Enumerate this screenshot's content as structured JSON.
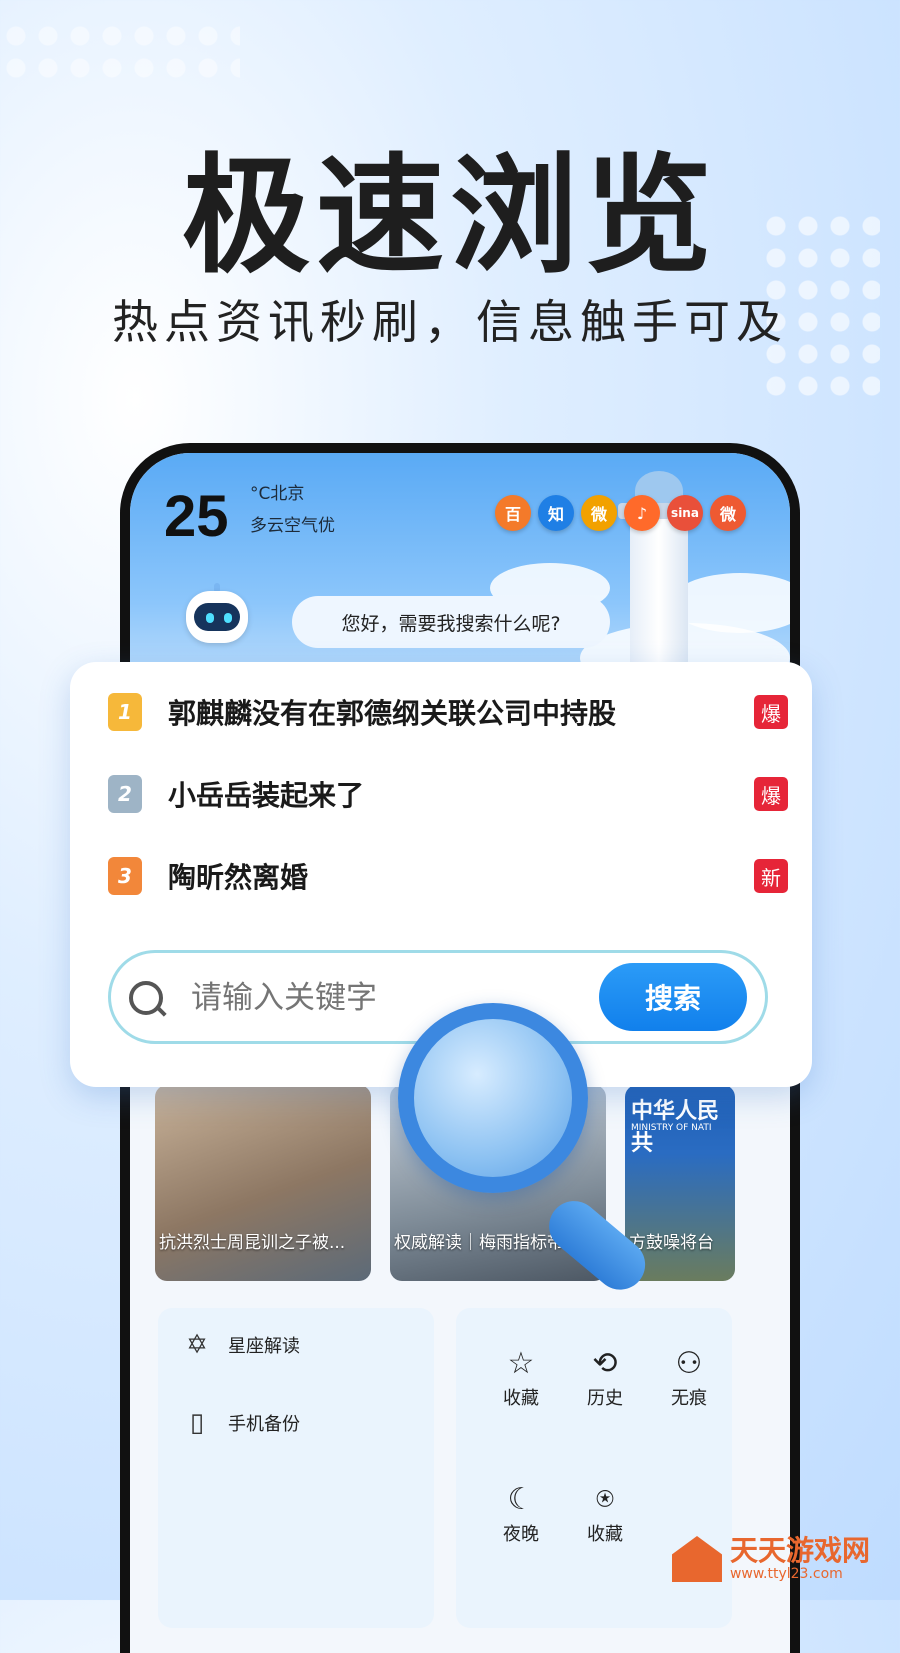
{
  "promo": {
    "headline": "极速浏览",
    "subline": "热点资讯秒刷，信息触手可及"
  },
  "weather": {
    "temperature": "25",
    "unit_city": "°C北京",
    "description": "多云空气优"
  },
  "apps": [
    {
      "icon": "baidu-icon",
      "glyph": "百",
      "color": "#f47a2a"
    },
    {
      "icon": "zhihu-icon",
      "glyph": "知",
      "color": "#1f7fe5"
    },
    {
      "icon": "weibo-icon",
      "glyph": "微",
      "color": "#f2a100"
    },
    {
      "icon": "douyin-icon",
      "glyph": "♪",
      "color": "#ff6a2a"
    },
    {
      "icon": "sina-icon",
      "glyph": "sina",
      "color": "#e9503a"
    },
    {
      "icon": "weibo-alt-icon",
      "glyph": "微",
      "color": "#ee5a32"
    }
  ],
  "assistant": {
    "greeting": "您好，需要我搜索什么呢?"
  },
  "hot_list": [
    {
      "rank": "1",
      "title": "郭麒麟没有在郭德纲关联公司中持股",
      "tag": "爆",
      "rank_color": "#f6b83a"
    },
    {
      "rank": "2",
      "title": "小岳岳装起来了",
      "tag": "爆",
      "rank_color": "#9eb4c6"
    },
    {
      "rank": "3",
      "title": "陶昕然离婚",
      "tag": "新",
      "rank_color": "#f2873a"
    }
  ],
  "search": {
    "placeholder": "请输入关键字",
    "button_label": "搜索"
  },
  "news": [
    {
      "caption": "抗洪烈士周昆训之子被..."
    },
    {
      "caption": "权威解读｜梅雨指标带"
    },
    {
      "caption": "方鼓噪将台",
      "banner": "中华人民共",
      "banner_sub": "MINISTRY OF NATI"
    }
  ],
  "tools_left": [
    {
      "label": "星座解读",
      "icon": "star-of-david-icon",
      "glyph": "✡"
    },
    {
      "label": "手机备份",
      "icon": "phone-backup-icon",
      "glyph": "▯"
    }
  ],
  "tools_right": [
    {
      "label": "收藏",
      "icon": "star-icon",
      "glyph": "☆"
    },
    {
      "label": "历史",
      "icon": "history-icon",
      "glyph": "⟲"
    },
    {
      "label": "无痕",
      "icon": "incognito-icon",
      "glyph": "⚇"
    },
    {
      "label": "夜晚",
      "icon": "moon-icon",
      "glyph": "☾"
    },
    {
      "label": "收藏",
      "icon": "bookmark-icon",
      "glyph": "⍟"
    }
  ],
  "watermark": {
    "title": "天天游戏网",
    "url": "www.ttyl23.com"
  }
}
